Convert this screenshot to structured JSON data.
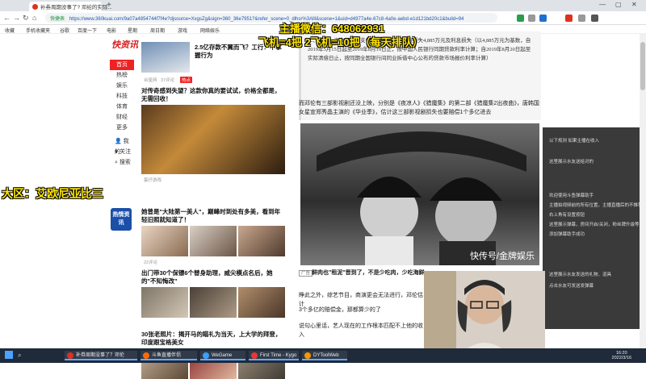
{
  "browser": {
    "tab_title": "补券周期没事了? 邓纶的实际...",
    "window_controls": [
      "—",
      "▢",
      "✕"
    ],
    "back": "←",
    "forward": "→",
    "reload": "↻",
    "home": "⌂",
    "secure_badge": "快捷表",
    "url": "https://www.360kuai.com/9a07a4854744f7f4e?djsource=XxgsZg&sign=360_36e7951?&refer_scene=0_dlhsr%3Alll&scene=1&uid=d4977a4e-67c8-4a0e-aebd-e1d121bd20c1&build=94",
    "bookmarks": [
      "收藏",
      "手机收藏夹",
      "谷歌",
      "百度一下",
      "电影",
      "星期",
      "周日期",
      "游戏",
      "网络娱乐"
    ]
  },
  "site": {
    "logo": "快资讯",
    "nav": [
      {
        "label": "首页",
        "active": true
      },
      {
        "label": "热榜",
        "active": false
      },
      {
        "label": "娱乐",
        "active": false
      },
      {
        "label": "科技",
        "active": false
      },
      {
        "label": "体育",
        "active": false
      },
      {
        "label": "财经",
        "active": false
      },
      {
        "label": "更多",
        "active": false
      }
    ],
    "side_actions": [
      "我的",
      "关注",
      "搜索"
    ],
    "red_logo": "热情资讯"
  },
  "feed": [
    {
      "title": "2.5亿存款不翼而飞？工行：不掌握行为",
      "source": "玖富",
      "time": "3小时前",
      "tag": "热点"
    },
    {
      "title": "对传奇感到失望？这款你真的要试试，价格全都是，无需回收！",
      "source": "蛋仔游戏",
      "time": "",
      "tag": ""
    },
    {
      "title": "她曾是\"大陆第一美人\"，巅峰时到处有多美，看到年轻旧照就知道了！",
      "source": "",
      "time": "22评论",
      "tag": ""
    },
    {
      "title": "出门带30个保镖6个替身助理，威尖模点名后，她的\"不知悔改\"",
      "source": "",
      "time": "",
      "tag": ""
    },
    {
      "title": "30张老照片：揭开马的瞄礼为当天，上大学的拜登，印度跟宝格美女",
      "source": "",
      "time": "",
      "tag": ""
    }
  ],
  "feed_meta": [
    "台星网",
    "37评论",
    "热点"
  ],
  "article": {
    "quote": "二、被告一于本周应当支付十日内向原告赔偿损失4,885万元及利息损失（以4,885万元为基数，自2019年5月15日起至2019年8月19日止，按中国人民银行同期贷款利率计算；自2019年8月20日起至实际清偿日止，按同期全国银行间同业拆借中心公布的贷款市场报价利率计算）",
    "para1": "而邓伦有三部影视剧还没上映，分别是《夜凉人》《猎魔集》的第二部《猎魔集2出夜曲》，唐韩国女星宣郑秀晶主演的《华业季》，估计这三部影视剧损失也要赔偿1个多亿进去",
    "watermark": "快传号/金牌娱乐",
    "heading": "鲜肉也\"租泥\"晋到了，不是少吃肉，少吃海鲜",
    "para2": "睁此之外，综艺节目，商演更会无法进行，邓伦估计",
    "para3": "3个多亿的赔偿金，那都算少的了",
    "para4": "说句心里话，艺人现在的工作根本匹配不上他的收入",
    "tag": "广告"
  },
  "overlays": {
    "streamer_id": "主播微信：648062931",
    "prices": "飞机=4把 2飞机=10把（每天排队）",
    "left_banner": "大区：艾欧尼亚比三"
  },
  "chat_panel": [
    {
      "text": "以下规则 如果主播在收入"
    },
    {
      "text": "这里展示水友送给对的"
    },
    {
      "text": "欢迎使用斗鱼弹幕助手"
    },
    {
      "text": "主播拍视频前的所有位置，主播直播后的不推荐主页"
    },
    {
      "text": "右上角有设置按钮"
    },
    {
      "text": "这里展示弹幕，房间开启/关闭，粉丝牌升级等"
    },
    {
      "text": "添加弹幕助手成功"
    },
    {
      "text": "这里展示水友发送的礼物、道具"
    },
    {
      "text": "点击水友可发送发弹幕"
    }
  ],
  "taskbar": {
    "items": [
      {
        "label": "补券周期没事了？邓伦",
        "color": "#e0301e"
      },
      {
        "label": "斗鱼直播伴侣",
        "color": "#ff6a00"
      },
      {
        "label": "WeGame",
        "color": "#3aa0ff"
      },
      {
        "label": "First Time - Kygo",
        "color": "#e33"
      },
      {
        "label": "DYToolWeb",
        "color": "#f39800"
      }
    ],
    "time": "16:20",
    "date": "2022/3/16"
  }
}
